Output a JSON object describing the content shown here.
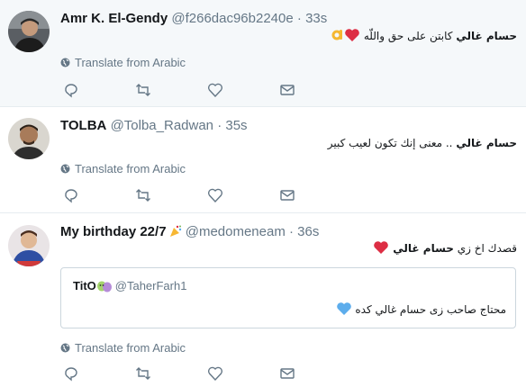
{
  "tweets": [
    {
      "name": "Amr K. El-Gendy",
      "handle": "@f266dac96b2240e",
      "separator": "·",
      "time": "33s",
      "text_bold": "حسام غالي",
      "text_rest": " كابتن على حق واللّه ",
      "translate": "Translate from Arabic"
    },
    {
      "name": "TOLBA",
      "handle": "@Tolba_Radwan",
      "separator": "·",
      "time": "35s",
      "text_bold": "حسام غالي",
      "text_rest": " .. معنى إنك تكون لعيب كبير",
      "translate": "Translate from Arabic"
    },
    {
      "name": "My birthday 22/7",
      "handle": "@medomeneam",
      "separator": "·",
      "time": "36s",
      "text_bold": "حسام غالي",
      "text_pre": "قصدك اخ زي ",
      "translate": "Translate from Arabic",
      "quote": {
        "name": "TitO",
        "handle": "@TaherFarh1",
        "text": "محتاج صاحب زى حسام غالي كده "
      }
    }
  ],
  "colors": {
    "accent": "#1da1f2",
    "secondary": "#657786",
    "heart": "#e0245e",
    "blue_heart": "#5dadec",
    "highlight_bg": "#f5f8fa"
  }
}
